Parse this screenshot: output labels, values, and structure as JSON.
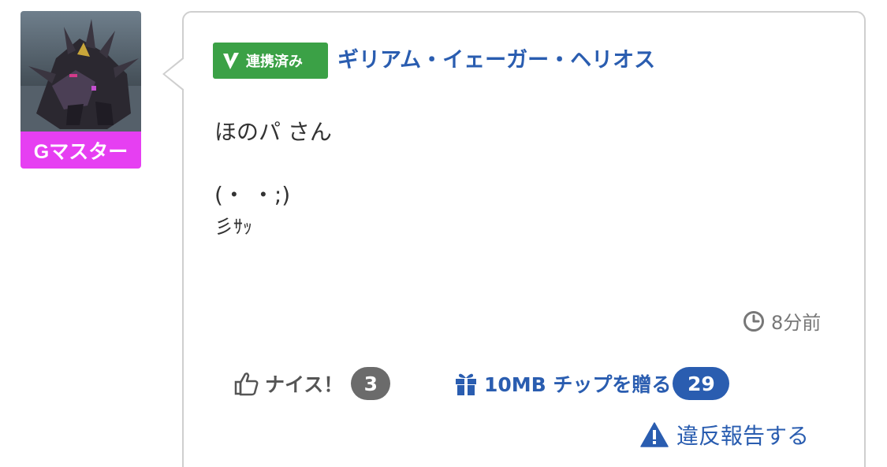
{
  "user": {
    "rank": "Gマスター",
    "linked_badge": "連携済み",
    "name": "ギリアム・イェーガー・ヘリオス"
  },
  "message": {
    "lines": [
      "ほのパ さん",
      "",
      "(・ ・;)",
      "彡ｻｯ"
    ]
  },
  "timestamp": "8分前",
  "actions": {
    "nice_label": "ナイス！",
    "nice_count": "3",
    "tip_label": "10MB チップを贈る",
    "tip_count": "29",
    "report_label": "違反報告する"
  },
  "icons": {
    "linked": "check-v-icon",
    "clock": "clock-icon",
    "nice": "thumbs-up-icon",
    "tip": "gift-icon",
    "report": "warning-icon"
  },
  "colors": {
    "rank_badge": "#e63ff2",
    "linked_badge": "#3ba146",
    "link_blue": "#2a5db0",
    "nice_count_bg": "#6b6b6b"
  }
}
